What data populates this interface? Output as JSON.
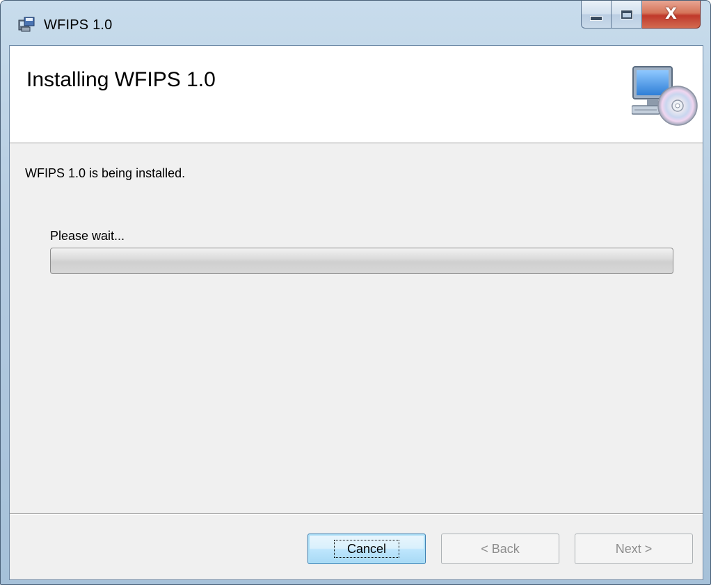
{
  "window": {
    "title": "WFIPS 1.0",
    "caption_buttons": {
      "minimize_icon": "minimize-icon",
      "maximize_icon": "maximize-icon",
      "close_glyph": "X"
    }
  },
  "banner": {
    "title": "Installing WFIPS 1.0",
    "icon": "computer-cd-icon"
  },
  "body": {
    "status_text": "WFIPS 1.0 is being installed.",
    "wait_text": "Please wait...",
    "progress": 0
  },
  "buttons": {
    "cancel": {
      "label": "Cancel",
      "enabled": true,
      "focused": true
    },
    "back": {
      "label": "< Back",
      "mnemonic": "B",
      "enabled": false
    },
    "next": {
      "label": "Next >",
      "mnemonic": "N",
      "enabled": false
    }
  },
  "colors": {
    "client_bg": "#f0f0f0",
    "banner_bg": "#ffffff",
    "frame": "#b4cbe0",
    "close_btn": "#c0392b"
  }
}
